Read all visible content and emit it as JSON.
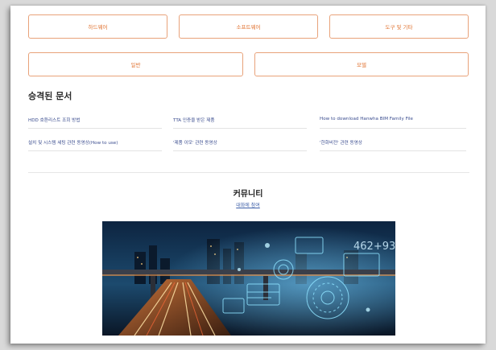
{
  "categories_row1": [
    {
      "label": "하드웨어"
    },
    {
      "label": "소프트웨어"
    },
    {
      "label": "도구 및 기타"
    }
  ],
  "categories_row2": [
    {
      "label": "일반"
    },
    {
      "label": "모델"
    }
  ],
  "approved_docs": {
    "title": "승격된 문서",
    "items": [
      {
        "label": "HDD 호환리스트 조회 방법"
      },
      {
        "label": "TTA 인증을 받은 제품"
      },
      {
        "label": "How to download Hanwha BIM Family File"
      },
      {
        "label": "설치 및 시스템 세팅 관련 동영상(How to use)"
      },
      {
        "label": "'제품 이모' 관련 동영상"
      },
      {
        "label": "'한화비전' 관련 동영상"
      }
    ]
  },
  "community": {
    "title": "커뮤니티",
    "link": "대화에 참여"
  },
  "colors": {
    "accent": "#e0712f",
    "border": "#e8a27a",
    "link": "#3b4d8f"
  }
}
